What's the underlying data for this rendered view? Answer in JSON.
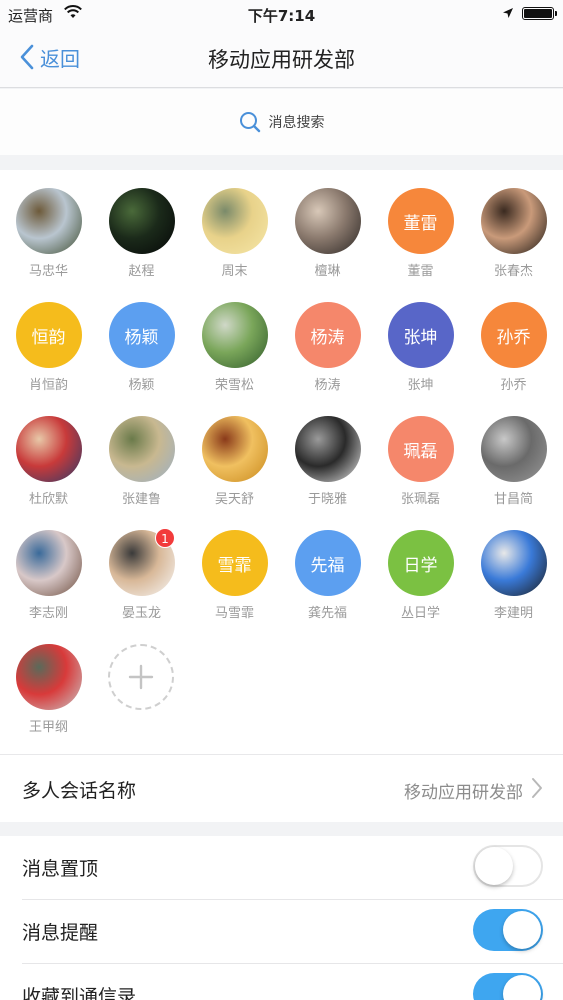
{
  "status_bar": {
    "carrier": "运营商",
    "time": "下午7:14"
  },
  "nav": {
    "back_label": "返回",
    "title": "移动应用研发部"
  },
  "search": {
    "label": "消息搜索"
  },
  "members": [
    {
      "name": "马忠华",
      "avatar_type": "photo",
      "colors": [
        "#3b4a2c",
        "#b9c5cf",
        "#6d5a3a"
      ]
    },
    {
      "name": "赵程",
      "avatar_type": "photo",
      "colors": [
        "#050607",
        "#1b2a1a",
        "#4a6a3a"
      ]
    },
    {
      "name": "周末",
      "avatar_type": "photo",
      "colors": [
        "#f6e7a8",
        "#e8d28a",
        "#7a8a6a"
      ]
    },
    {
      "name": "檀琳",
      "avatar_type": "photo",
      "colors": [
        "#2a2523",
        "#8b7a6e",
        "#d8c8b8"
      ]
    },
    {
      "name": "董雷",
      "avatar_type": "text",
      "text": "董雷",
      "color": "#f6873b"
    },
    {
      "name": "张春杰",
      "avatar_type": "photo",
      "colors": [
        "#1a1612",
        "#c99a7a",
        "#3a2a20"
      ]
    },
    {
      "name": "肖恒韵",
      "avatar_type": "text",
      "text": "恒韵",
      "color": "#f5bc1c"
    },
    {
      "name": "杨颖",
      "avatar_type": "text",
      "text": "杨颖",
      "color": "#5c9ff0"
    },
    {
      "name": "荣雪松",
      "avatar_type": "photo",
      "colors": [
        "#2f5a2a",
        "#7aa65a",
        "#d0d8c8"
      ]
    },
    {
      "name": "杨涛",
      "avatar_type": "text",
      "text": "杨涛",
      "color": "#f5876b"
    },
    {
      "name": "张坤",
      "avatar_type": "text",
      "text": "张坤",
      "color": "#5866c8"
    },
    {
      "name": "孙乔",
      "avatar_type": "text",
      "text": "孙乔",
      "color": "#f6873b"
    },
    {
      "name": "杜欣默",
      "avatar_type": "photo",
      "colors": [
        "#2a3a6a",
        "#c83a3a",
        "#e8c8a8"
      ]
    },
    {
      "name": "张建鲁",
      "avatar_type": "photo",
      "colors": [
        "#9ab0c8",
        "#c8b890",
        "#6a7a4a"
      ]
    },
    {
      "name": "吴天舒",
      "avatar_type": "photo",
      "colors": [
        "#c8881a",
        "#f0c060",
        "#8a3a1a"
      ]
    },
    {
      "name": "于晓雅",
      "avatar_type": "photo",
      "colors": [
        "#e8e8e8",
        "#2a2a2a",
        "#9a9a9a"
      ]
    },
    {
      "name": "张珮磊",
      "avatar_type": "text",
      "text": "珮磊",
      "color": "#f5876b"
    },
    {
      "name": "甘昌简",
      "avatar_type": "photo",
      "colors": [
        "#9a9a9a",
        "#6a6a6a",
        "#c8c8c8"
      ]
    },
    {
      "name": "李志刚",
      "avatar_type": "photo",
      "colors": [
        "#6a4a3a",
        "#d8c8c8",
        "#3a6a9a"
      ]
    },
    {
      "name": "晏玉龙",
      "avatar_type": "photo",
      "colors": [
        "#f8f8f8",
        "#d8b898",
        "#3a3a3a"
      ],
      "badge": "1"
    },
    {
      "name": "马雪霏",
      "avatar_type": "text",
      "text": "雪霏",
      "color": "#f5bc1c"
    },
    {
      "name": "龚先福",
      "avatar_type": "text",
      "text": "先福",
      "color": "#5c9ff0"
    },
    {
      "name": "丛日学",
      "avatar_type": "text",
      "text": "日学",
      "color": "#7bc142"
    },
    {
      "name": "李建明",
      "avatar_type": "photo",
      "colors": [
        "#1a1a1a",
        "#3a7ad8",
        "#e8e8e8"
      ]
    },
    {
      "name": "王甲纲",
      "avatar_type": "photo",
      "colors": [
        "#c8c8c8",
        "#d83a3a",
        "#5a6a5a"
      ]
    }
  ],
  "group_name": {
    "label": "多人会话名称",
    "value": "移动应用研发部"
  },
  "settings": [
    {
      "label": "消息置顶",
      "toggle": "off"
    },
    {
      "label": "消息提醒",
      "toggle": "on"
    },
    {
      "label": "收藏到通信录",
      "toggle": "on"
    }
  ],
  "colors": {
    "accent": "#3ea6f0",
    "nav_text": "#4a90d9"
  }
}
